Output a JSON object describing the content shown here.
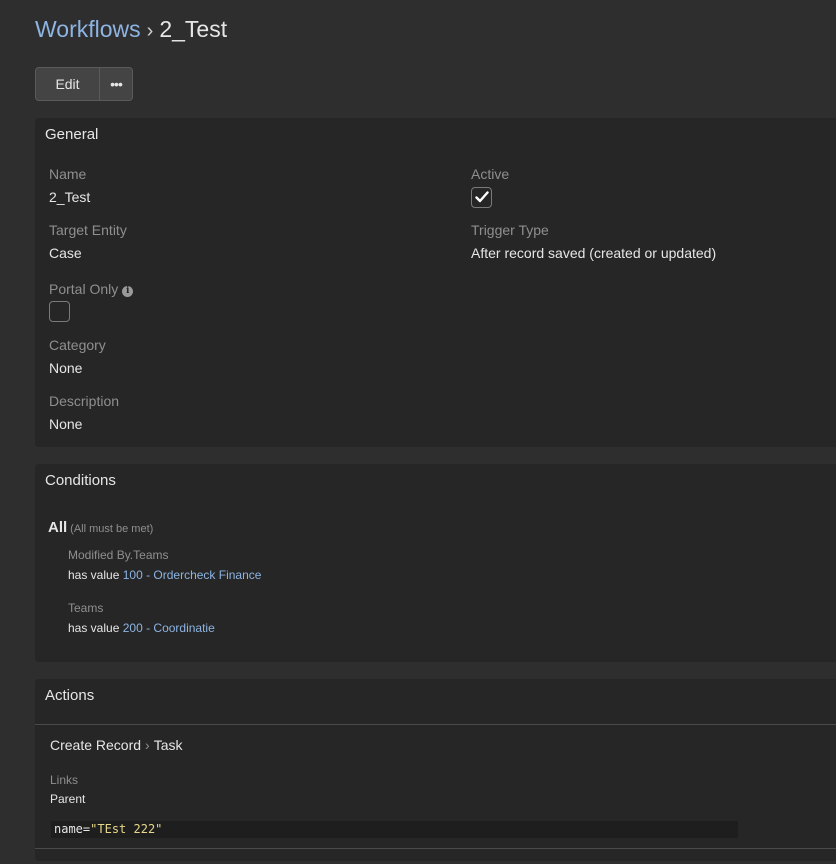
{
  "breadcrumb": {
    "parent": "Workflows",
    "separator": "›",
    "current": "2_Test"
  },
  "toolbar": {
    "edit_label": "Edit",
    "more_label": "•••"
  },
  "general": {
    "title": "General",
    "name_label": "Name",
    "name_value": "2_Test",
    "active_label": "Active",
    "active_checked": true,
    "target_entity_label": "Target Entity",
    "target_entity_value": "Case",
    "trigger_type_label": "Trigger Type",
    "trigger_type_value": "After record saved (created or updated)",
    "portal_only_label": "Portal Only",
    "portal_only_checked": false,
    "info_icon": "i",
    "category_label": "Category",
    "category_value": "None",
    "description_label": "Description",
    "description_value": "None"
  },
  "conditions": {
    "title": "Conditions",
    "group_label": "All",
    "group_note": "(All must be met)",
    "items": [
      {
        "field": "Modified By.Teams",
        "operator": "has value",
        "value": "100 - Ordercheck Finance"
      },
      {
        "field": "Teams",
        "operator": "has value",
        "value": "200 - Coordinatie"
      }
    ]
  },
  "actions": {
    "title": "Actions",
    "action_type": "Create Record",
    "separator": "›",
    "action_entity": "Task",
    "links_label": "Links",
    "links_value": "Parent",
    "formula_key": "name",
    "formula_op": "=",
    "formula_value": "\"TEst 222\""
  },
  "colors": {
    "background": "#2e2e2e",
    "panel": "#262626",
    "link": "#8db4e2",
    "string": "#e6d88a"
  }
}
